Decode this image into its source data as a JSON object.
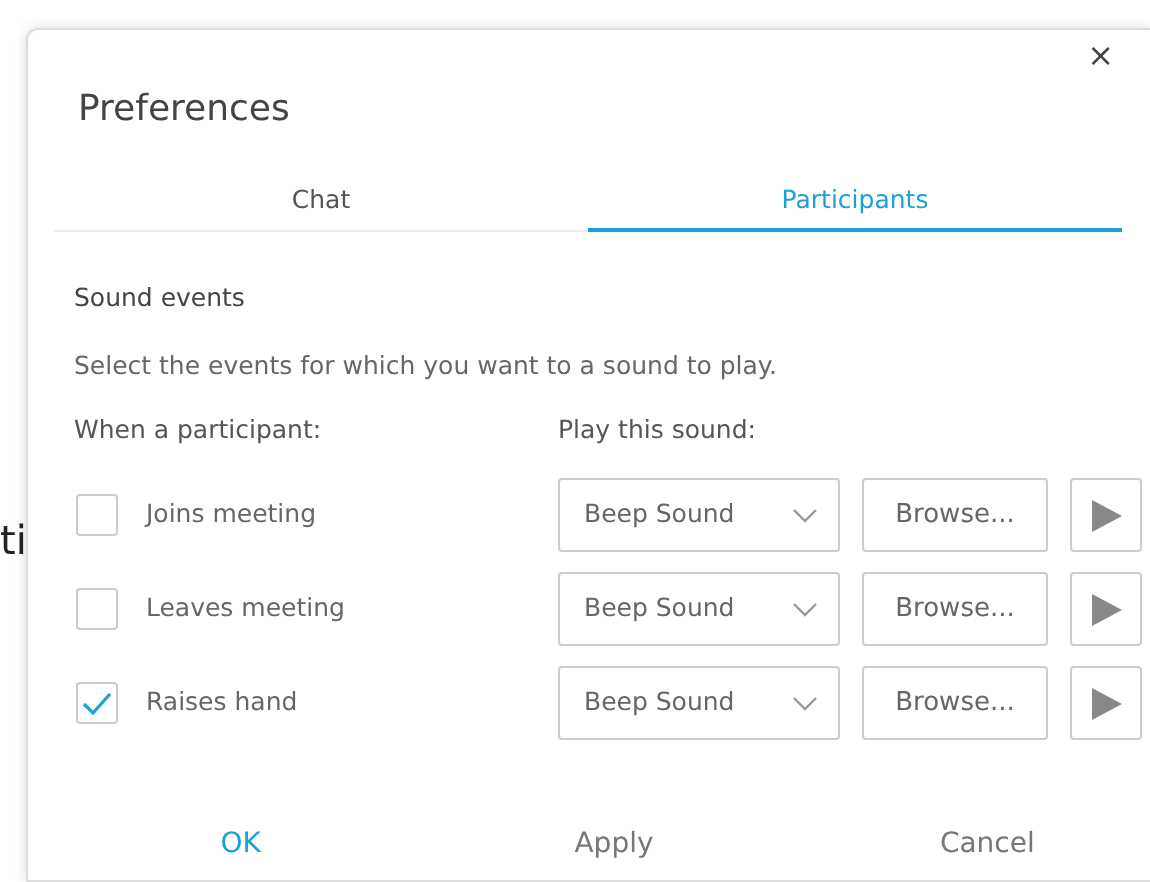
{
  "background_text": "ti",
  "dialog": {
    "title": "Preferences",
    "close": "×"
  },
  "tabs": [
    {
      "label": "Chat",
      "selected": false
    },
    {
      "label": "Participants",
      "selected": true
    }
  ],
  "section_title": "Sound events",
  "description": "Select the events for which you want to a sound to play.",
  "headers": [
    "When a participant:",
    "Play this sound:"
  ],
  "events": [
    {
      "label": "Joins meeting",
      "checked": false,
      "sound": "Beep Sound",
      "browse": "Browse..."
    },
    {
      "label": "Leaves meeting",
      "checked": false,
      "sound": "Beep Sound",
      "browse": "Browse..."
    },
    {
      "label": "Raises hand",
      "checked": true,
      "sound": "Beep Sound",
      "browse": "Browse..."
    }
  ],
  "buttons": [
    {
      "label": "OK",
      "kind": "primary"
    },
    {
      "label": "Apply",
      "kind": "plain"
    },
    {
      "label": "Cancel",
      "kind": "plain"
    }
  ]
}
